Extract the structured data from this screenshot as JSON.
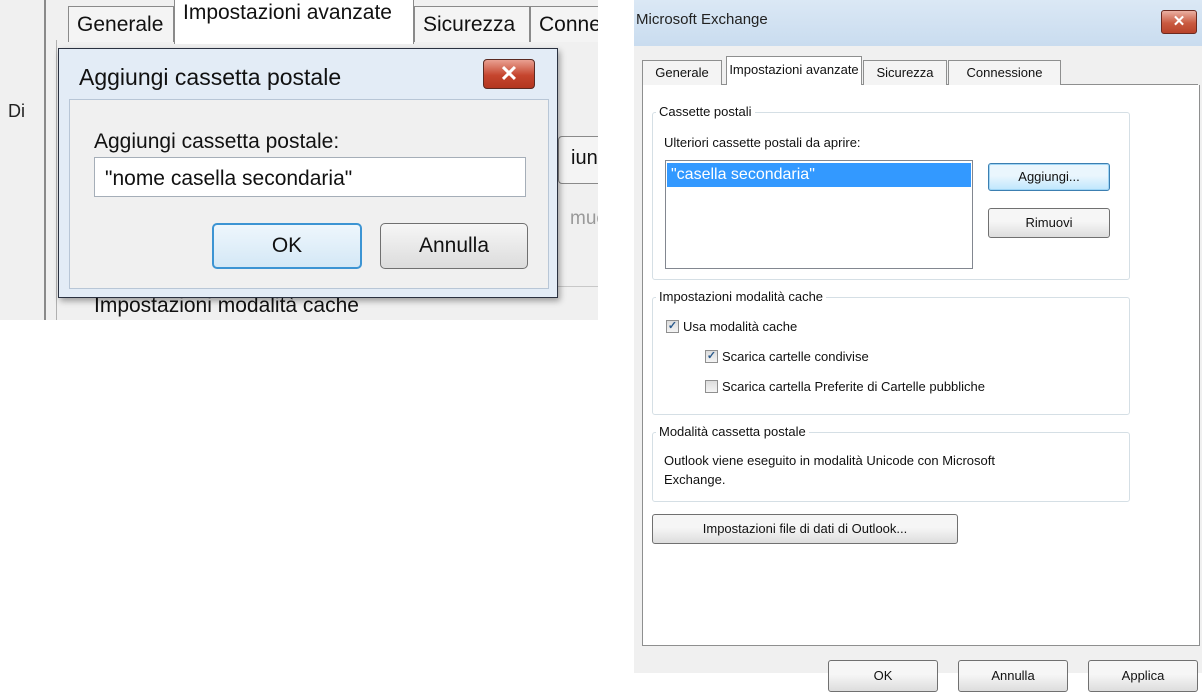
{
  "left": {
    "tabs": [
      "Generale",
      "Impostazioni avanzate",
      "Sicurezza",
      "Conne"
    ],
    "side_label": "Di",
    "bg_add_label": "iung",
    "bg_remove_label": "muo",
    "cache_label": "Impostazioni modalità cache",
    "dialog": {
      "title": "Aggiungi cassetta postale",
      "field_label": "Aggiungi cassetta postale:",
      "field_value": "\"nome casella secondaria\"",
      "ok_label": "OK",
      "cancel_label": "Annulla"
    }
  },
  "right": {
    "title": "Microsoft Exchange",
    "tabs": [
      "Generale",
      "Impostazioni avanzate",
      "Sicurezza",
      "Connessione"
    ],
    "mailboxes_group": "Cassette postali",
    "mailboxes_label": "Ulteriori cassette postali da aprire:",
    "mailboxes_items": [
      "\"casella secondaria\""
    ],
    "add_button": "Aggiungi...",
    "remove_button": "Rimuovi",
    "cache_group": "Impostazioni modalità cache",
    "use_cache_label": "Usa modalità cache",
    "use_cache_checked": true,
    "download_shared_label": "Scarica cartelle condivise",
    "download_shared_checked": true,
    "download_favorites_label": "Scarica cartella Preferite di Cartelle pubbliche",
    "download_favorites_checked": false,
    "mailbox_mode_group": "Modalità cassetta postale",
    "mailbox_mode_text_1": "Outlook viene eseguito in modalità Unicode con Microsoft",
    "mailbox_mode_text_2": "Exchange.",
    "data_file_button": "Impostazioni file di dati di Outlook...",
    "ok_button": "OK",
    "cancel_button": "Annulla",
    "apply_button": "Applica"
  },
  "icons": {
    "close": "close-icon",
    "checkmark": "checkmark-icon"
  },
  "colors": {
    "selection": "#3399ff",
    "close_button": "#c5452e",
    "titlebar": "#c9dcef"
  }
}
